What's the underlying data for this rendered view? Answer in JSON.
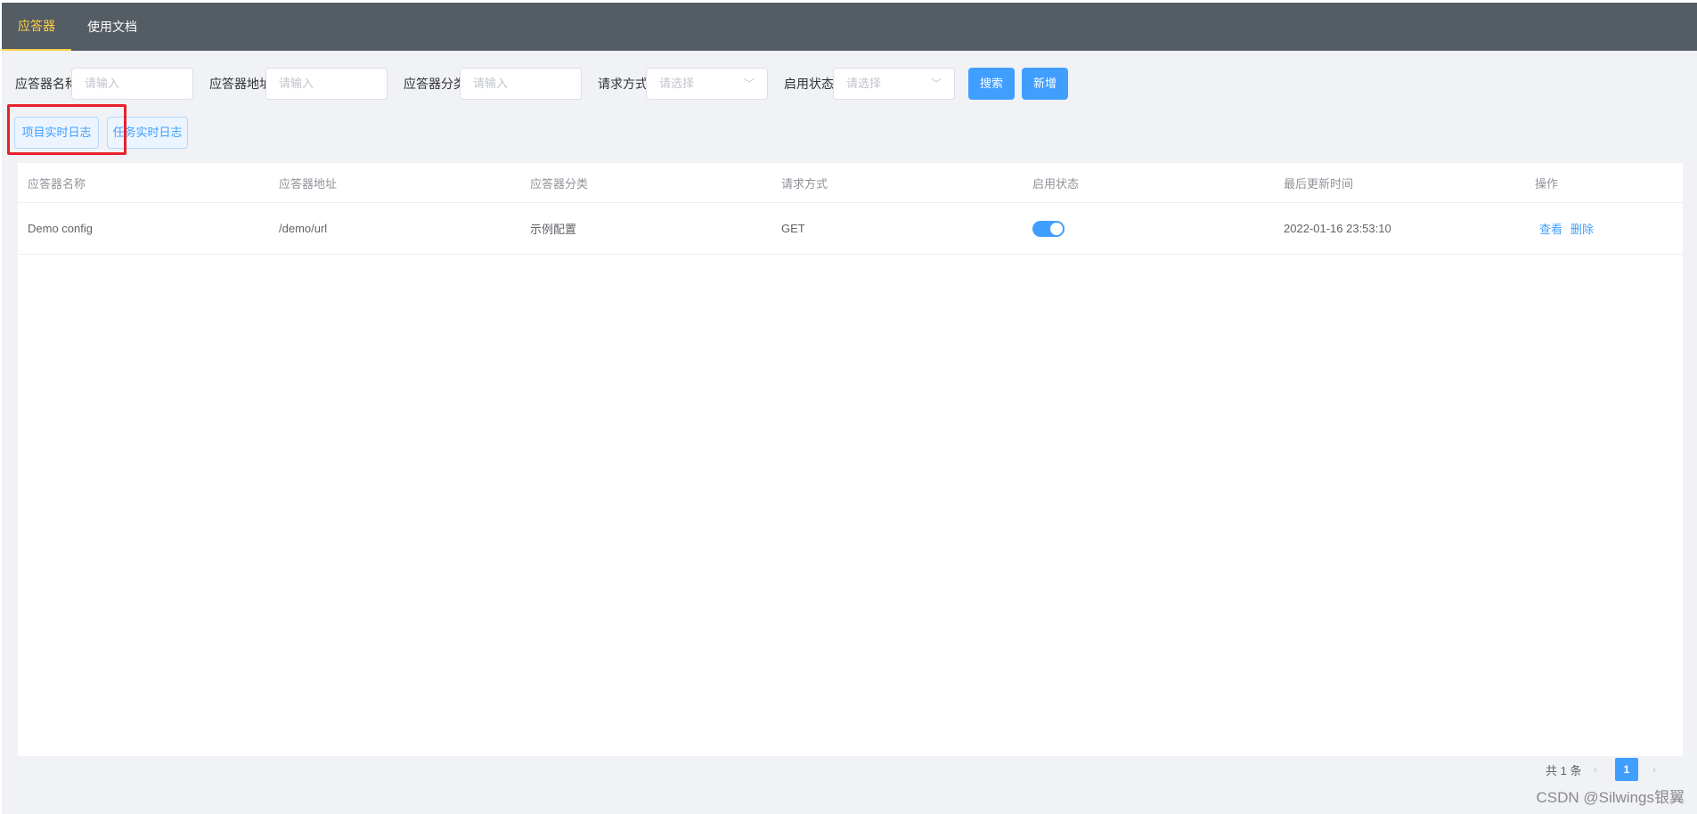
{
  "nav": {
    "tabs": [
      {
        "label": "应答器",
        "active": true
      },
      {
        "label": "使用文档",
        "active": false
      }
    ]
  },
  "filters": {
    "name_label": "应答器名称",
    "name_placeholder": "请输入",
    "address_label": "应答器地址",
    "address_placeholder": "请输入",
    "category_label": "应答器分类",
    "category_placeholder": "请输入",
    "method_label": "请求方式",
    "method_placeholder": "请选择",
    "status_label": "启用状态",
    "status_placeholder": "请选择",
    "search_button": "搜索",
    "add_button": "新增"
  },
  "actions": {
    "project_log_button": "项目实时日志",
    "task_log_button": "任务实时日志"
  },
  "table": {
    "headers": [
      "应答器名称",
      "应答器地址",
      "应答器分类",
      "请求方式",
      "启用状态",
      "最后更新时间",
      "操作"
    ],
    "rows": [
      {
        "name": "Demo config",
        "address": "/demo/url",
        "category": "示例配置",
        "method": "GET",
        "enabled": true,
        "updated": "2022-01-16 23:53:10",
        "view": "查看",
        "delete": "删除"
      }
    ]
  },
  "pagination": {
    "total": "共 1 条",
    "prev_icon": "‹",
    "current_page": "1",
    "next_icon": "›"
  },
  "watermark": "CSDN @Silwings银翼",
  "colors": {
    "nav_bg": "#545c64",
    "nav_active": "#ffd04b",
    "primary": "#409eff",
    "highlight_box": "#e8202a"
  }
}
